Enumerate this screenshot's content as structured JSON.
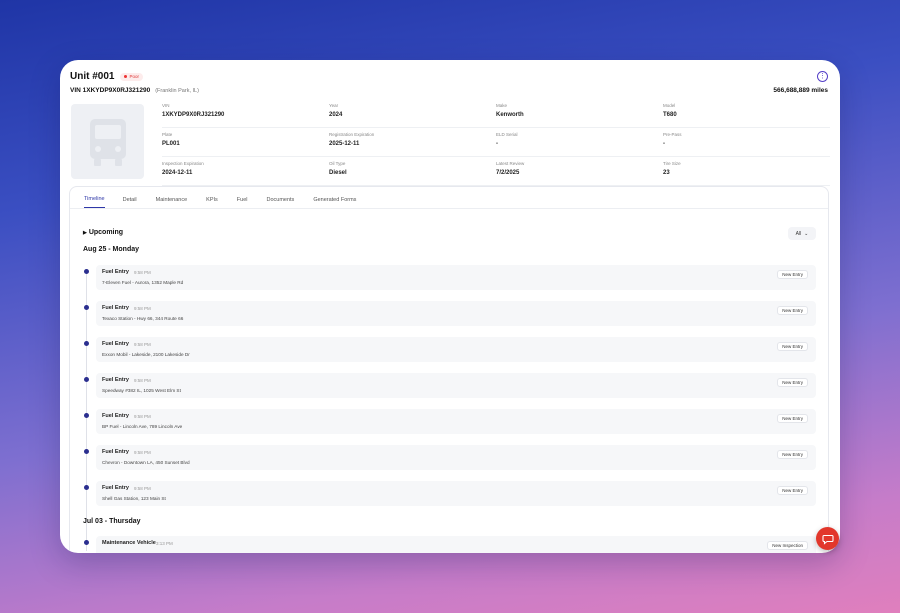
{
  "header": {
    "unit_title": "Unit #001",
    "status_badge": "Poor",
    "vin_line": "VIN 1XKYDP9X0RJ321290",
    "location": "(Franklin Park, IL)",
    "miles": "566,688,889 miles",
    "more_icon": "more-vertical-icon"
  },
  "specs": {
    "rows": [
      [
        {
          "label": "VIN",
          "value": "1XKYDP9X0RJ321290"
        },
        {
          "label": "Year",
          "value": "2024"
        },
        {
          "label": "Make",
          "value": "Kenworth"
        },
        {
          "label": "Model",
          "value": "T680"
        }
      ],
      [
        {
          "label": "Plate",
          "value": "PL001"
        },
        {
          "label": "Registration Expiration",
          "value": "2025-12-11"
        },
        {
          "label": "ELD Serial",
          "value": "-"
        },
        {
          "label": "Pre-Pass",
          "value": "-"
        }
      ],
      [
        {
          "label": "Inspection Expiration",
          "value": "2024-12-11"
        },
        {
          "label": "Oil Type",
          "value": "Diesel"
        },
        {
          "label": "Latest Review",
          "value": "7/2/2025"
        },
        {
          "label": "Tire Size",
          "value": "23"
        }
      ]
    ]
  },
  "tabs": [
    "Timeline",
    "Detail",
    "Maintenance",
    "KPIs",
    "Fuel",
    "Documents",
    "Generated Forms"
  ],
  "timeline": {
    "upcoming_label": "Upcoming",
    "filter_value": "All",
    "days": [
      {
        "heading": "Aug 25 - Monday",
        "entries": [
          {
            "title": "Fuel Entry",
            "time": "9:58 PM",
            "location": "7-Eleven Fuel - Aurora, 1352 Maple Rd",
            "tag": "New Entry"
          },
          {
            "title": "Fuel Entry",
            "time": "9:58 PM",
            "location": "Texaco Station - Hwy 66, 344 Route 66",
            "tag": "New Entry"
          },
          {
            "title": "Fuel Entry",
            "time": "9:58 PM",
            "location": "Exxon Mobil - Lakeside, 2100 Lakeside Dr",
            "tag": "New Entry"
          },
          {
            "title": "Fuel Entry",
            "time": "9:58 PM",
            "location": "Speedway #382 IL, 1025 West Elm St",
            "tag": "New Entry"
          },
          {
            "title": "Fuel Entry",
            "time": "9:58 PM",
            "location": "BP Fuel - Lincoln Ave, 789 Lincoln Ave",
            "tag": "New Entry"
          },
          {
            "title": "Fuel Entry",
            "time": "9:58 PM",
            "location": "Chevron - Downtown LA, 450 Sunset Blvd",
            "tag": "New Entry"
          },
          {
            "title": "Fuel Entry",
            "time": "9:58 PM",
            "location": "Shell Gas Station, 123 Main St",
            "tag": "New Entry"
          }
        ]
      },
      {
        "heading": "Jul 03 - Thursday",
        "entries": [
          {
            "title": "Maintenance Vehicle",
            "time": "3:13 PM",
            "location": "",
            "tag": "New Inspection"
          }
        ]
      }
    ]
  },
  "colors": {
    "accent": "#2e37a8",
    "badge": "#e33333",
    "chat": "#e2372b"
  }
}
